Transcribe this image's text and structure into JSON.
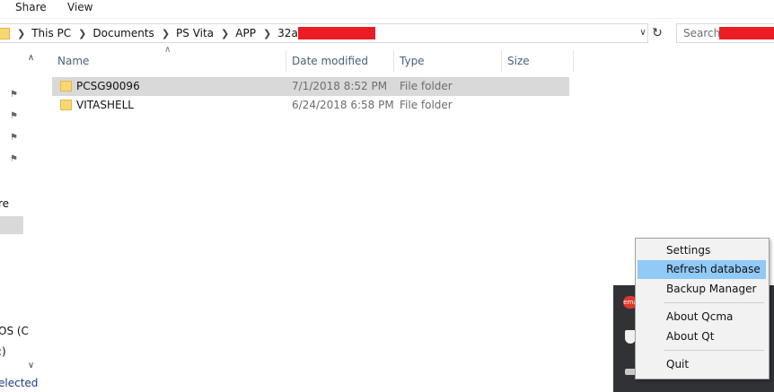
{
  "ribbon": {
    "share_tab": "Share",
    "view_tab": "View"
  },
  "address_bar": {
    "crumbs": [
      "This PC",
      "Documents",
      "PS Vita",
      "APP",
      "32a"
    ],
    "search_placeholder": "Search 3"
  },
  "nav_pane": {
    "partial_labels": [
      "re",
      "OS (C",
      ":)"
    ],
    "status_partial": "elected"
  },
  "columns": {
    "name": "Name",
    "date": "Date modified",
    "type": "Type",
    "size": "Size"
  },
  "files": [
    {
      "name": "PCSG90096",
      "date": "7/1/2018 8:52 PM",
      "type": "File folder",
      "selected": true
    },
    {
      "name": "VITASHELL",
      "date": "6/24/2018 6:58 PM",
      "type": "File folder",
      "selected": false
    }
  ],
  "tray": {
    "qcma_label": "ema"
  },
  "context_menu": {
    "items": [
      "Settings",
      "Refresh database",
      "Backup Manager",
      "About Qcma",
      "About Qt",
      "Quit"
    ],
    "highlighted": "Refresh database"
  },
  "colors": {
    "highlight": "#91c9f7",
    "selection": "#d9d9d9",
    "redaction": "#ec1c24",
    "tray": "#303236"
  }
}
